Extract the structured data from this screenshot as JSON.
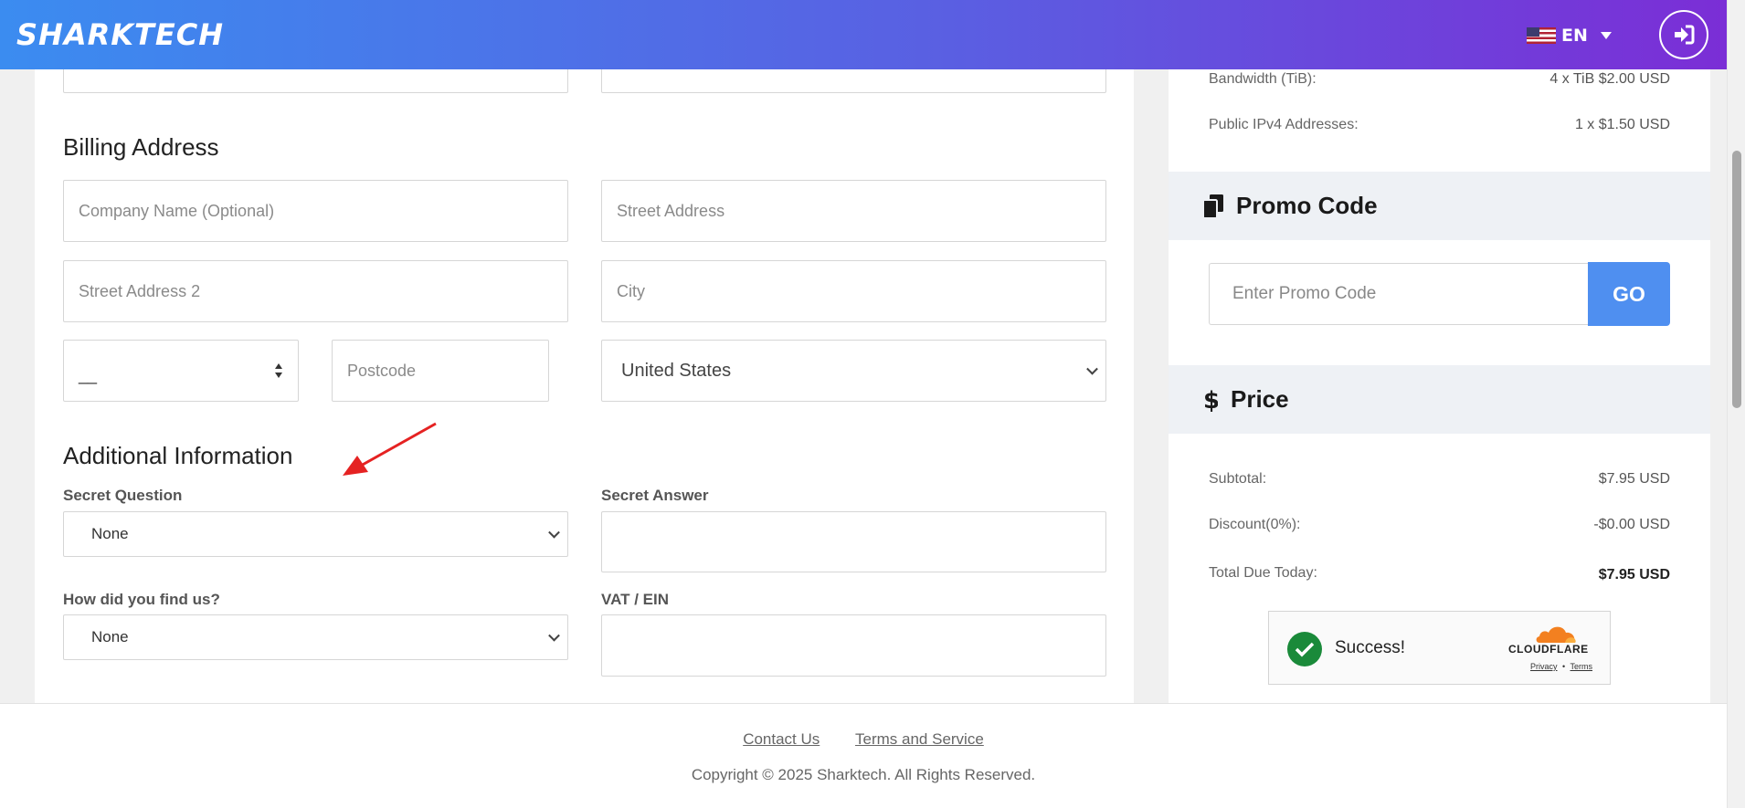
{
  "header": {
    "logo": "SHARKTECH",
    "language": "EN"
  },
  "billing": {
    "title": "Billing Address",
    "company_placeholder": "Company Name (Optional)",
    "street_placeholder": "Street Address",
    "street2_placeholder": "Street Address 2",
    "city_placeholder": "City",
    "state_value": "__",
    "postcode_placeholder": "Postcode",
    "country_value": "United States"
  },
  "additional": {
    "title": "Additional Information",
    "secret_question_label": "Secret Question",
    "secret_question_value": "None",
    "secret_answer_label": "Secret Answer",
    "find_us_label": "How did you find us?",
    "find_us_value": "None",
    "vat_label": "VAT / EIN"
  },
  "summary": {
    "bandwidth_label": "Bandwidth (TiB):",
    "bandwidth_value": "4 x TiB $2.00 USD",
    "ipv4_label": "Public IPv4 Addresses:",
    "ipv4_value": "1 x $1.50 USD"
  },
  "promo": {
    "title": "Promo Code",
    "placeholder": "Enter Promo Code",
    "button": "GO"
  },
  "price": {
    "title": "Price",
    "subtotal_label": "Subtotal:",
    "subtotal_value": "$7.95 USD",
    "discount_label": "Discount(0%):",
    "discount_value": "-$0.00 USD",
    "total_label": "Total Due Today:",
    "total_value": "$7.95 USD"
  },
  "captcha": {
    "status": "Success!",
    "brand": "CLOUDFLARE",
    "privacy": "Privacy",
    "separator": "•",
    "terms": "Terms"
  },
  "footer": {
    "contact": "Contact Us",
    "terms": "Terms and Service",
    "copyright": "Copyright © 2025 Sharktech. All Rights Reserved."
  },
  "colors": {
    "header_start": "#3b8cf0",
    "header_end": "#7b2ed6",
    "go_button": "#4f8ff0",
    "success_green": "#1a8a3a",
    "annotation_arrow": "#e52222"
  }
}
